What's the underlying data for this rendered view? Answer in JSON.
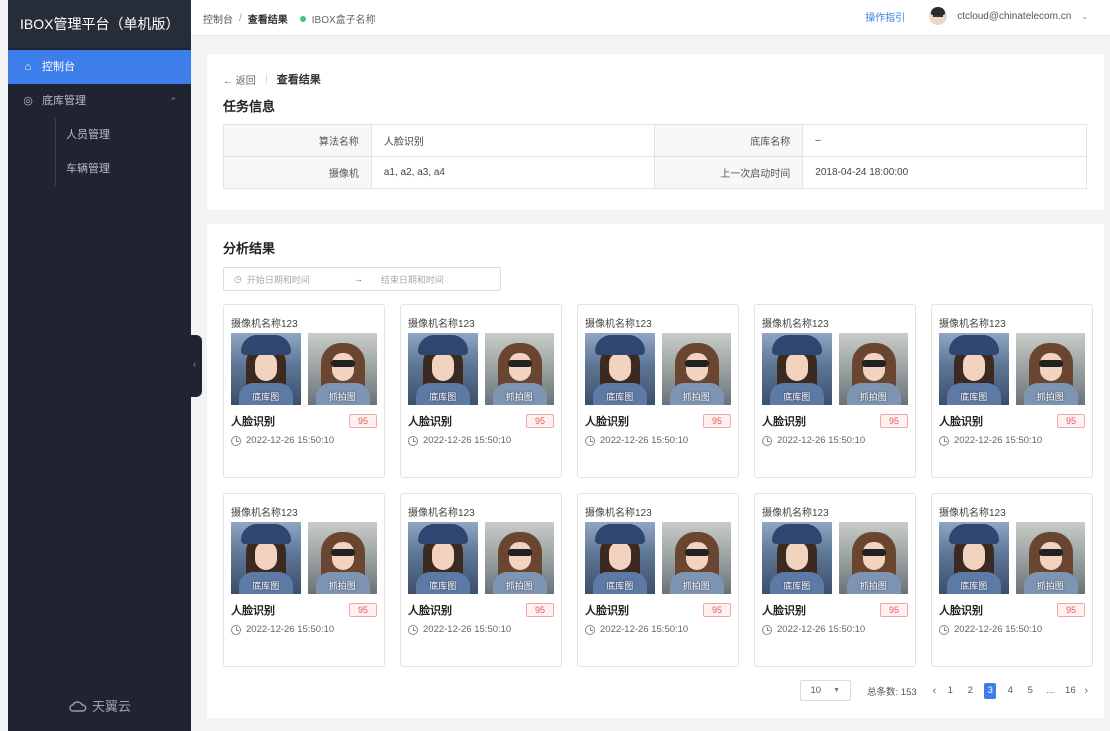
{
  "app": {
    "title": "IBOX管理平台（单机版）",
    "footer_brand": "天翼云"
  },
  "sidebar": {
    "items": [
      {
        "label": "控制台",
        "icon": "home-icon",
        "active": true
      },
      {
        "label": "底库管理",
        "icon": "database-icon",
        "active": false
      }
    ],
    "subitems": [
      {
        "label": "人员管理"
      },
      {
        "label": "车辆管理"
      }
    ]
  },
  "header": {
    "breadcrumb": [
      "控制台",
      "查看结果"
    ],
    "device_name": "IBOX盒子名称",
    "guide": "操作指引",
    "user": "ctcloud@chinatelecom.cn"
  },
  "page": {
    "back": "返回",
    "title": "查看结果"
  },
  "task_info": {
    "title": "任务信息",
    "rows": [
      [
        {
          "label": "算法名称",
          "value": "人脸识别"
        },
        {
          "label": "底库名称",
          "value": "–"
        }
      ],
      [
        {
          "label": "摄像机",
          "value": "a1, a2, a3, a4"
        },
        {
          "label": "上一次启动时间",
          "value": "2018-04-24 18:00:00"
        }
      ]
    ]
  },
  "results": {
    "title": "分析结果",
    "date_start_placeholder": "开始日期和时间",
    "date_end_placeholder": "结束日期和时间",
    "cards": [
      {
        "camera": "摄像机名称123",
        "base_tag": "底库图",
        "capture_tag": "抓拍图",
        "algo": "人脸识别",
        "score": "95",
        "time": "2022-12-26 15:50:10"
      },
      {
        "camera": "摄像机名称123",
        "base_tag": "底库图",
        "capture_tag": "抓拍图",
        "algo": "人脸识别",
        "score": "95",
        "time": "2022-12-26 15:50:10"
      },
      {
        "camera": "摄像机名称123",
        "base_tag": "底库图",
        "capture_tag": "抓拍图",
        "algo": "人脸识别",
        "score": "95",
        "time": "2022-12-26 15:50:10"
      },
      {
        "camera": "摄像机名称123",
        "base_tag": "底库图",
        "capture_tag": "抓拍图",
        "algo": "人脸识别",
        "score": "95",
        "time": "2022-12-26 15:50:10"
      },
      {
        "camera": "摄像机名称123",
        "base_tag": "底库图",
        "capture_tag": "抓拍图",
        "algo": "人脸识别",
        "score": "95",
        "time": "2022-12-26 15:50:10"
      },
      {
        "camera": "摄像机名称123",
        "base_tag": "底库图",
        "capture_tag": "抓拍图",
        "algo": "人脸识别",
        "score": "95",
        "time": "2022-12-26 15:50:10"
      },
      {
        "camera": "摄像机名称123",
        "base_tag": "底库图",
        "capture_tag": "抓拍图",
        "algo": "人脸识别",
        "score": "95",
        "time": "2022-12-26 15:50:10"
      },
      {
        "camera": "摄像机名称123",
        "base_tag": "底库图",
        "capture_tag": "抓拍图",
        "algo": "人脸识别",
        "score": "95",
        "time": "2022-12-26 15:50:10"
      },
      {
        "camera": "摄像机名称123",
        "base_tag": "底库图",
        "capture_tag": "抓拍图",
        "algo": "人脸识别",
        "score": "95",
        "time": "2022-12-26 15:50:10"
      },
      {
        "camera": "摄像机名称123",
        "base_tag": "底库图",
        "capture_tag": "抓拍图",
        "algo": "人脸识别",
        "score": "95",
        "time": "2022-12-26 15:50:10"
      }
    ]
  },
  "pagination": {
    "page_size": "10",
    "total": "总条数: 153",
    "pages": [
      "1",
      "2",
      "3",
      "4",
      "5",
      "...",
      "16"
    ],
    "current": "3"
  },
  "colors": {
    "accent": "#3d7eea",
    "sidebar": "#1f2430",
    "score": "#e35b5b",
    "status_dot": "#45c27a"
  }
}
